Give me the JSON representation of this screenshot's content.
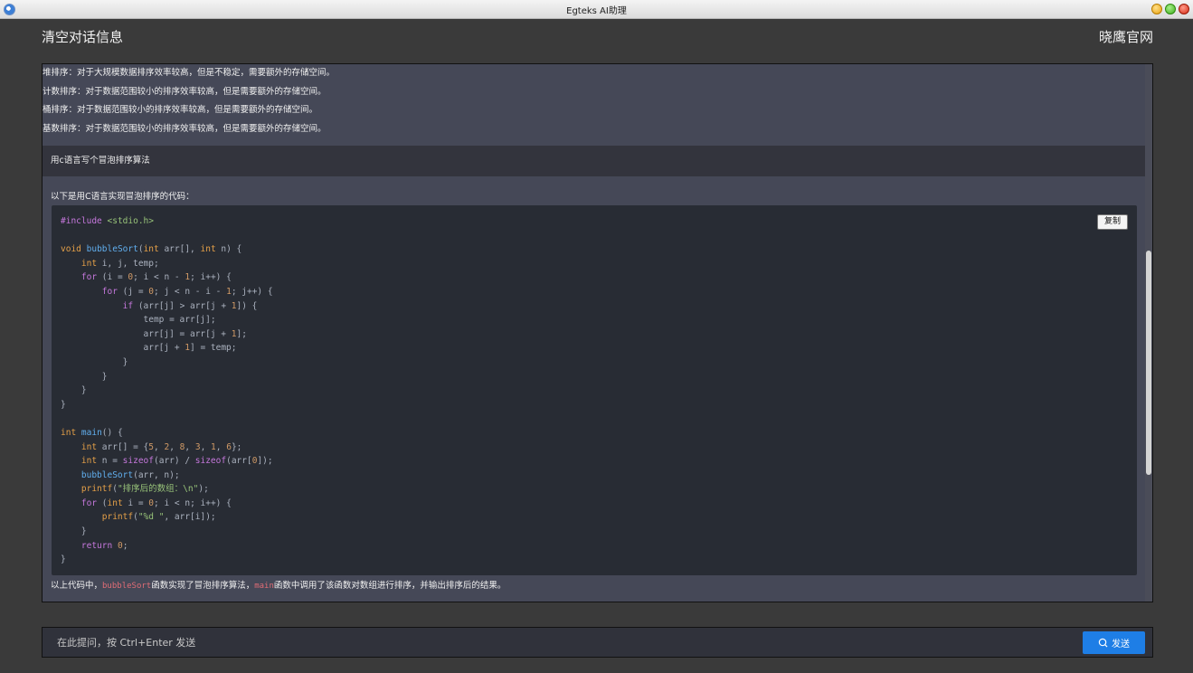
{
  "window": {
    "title": "Egteks AI助理"
  },
  "header": {
    "clear_label": "清空对话信息",
    "site_label": "晓鹰官网"
  },
  "chat": {
    "previous_lines": [
      "堆排序：对于大规模数据排序效率较高，但是不稳定，需要额外的存储空间。",
      "计数排序：对于数据范围较小的排序效率较高，但是需要额外的存储空间。",
      "桶排序：对于数据范围较小的排序效率较高，但是需要额外的存储空间。",
      "基数排序：对于数据范围较小的排序效率较高，但是需要额外的存储空间。"
    ],
    "user_message": "用c语言写个冒泡排序算法",
    "ai_intro": "以下是用C语言实现冒泡排序的代码：",
    "copy_label": "复制",
    "outro": {
      "part1": "以上代码中，",
      "code1": "bubbleSort",
      "part2": "函数实现了冒泡排序算法，",
      "code2": "main",
      "part3": "函数中调用了该函数对数组进行排序，并输出排序后的结果。"
    }
  },
  "code_lines": [
    "#include <stdio.h>",
    "",
    "void bubbleSort(int arr[], int n) {",
    "    int i, j, temp;",
    "    for (i = 0; i < n - 1; i++) {",
    "        for (j = 0; j < n - i - 1; j++) {",
    "            if (arr[j] > arr[j + 1]) {",
    "                temp = arr[j];",
    "                arr[j] = arr[j + 1];",
    "                arr[j + 1] = temp;",
    "            }",
    "        }",
    "    }",
    "}",
    "",
    "int main() {",
    "    int arr[] = {5, 2, 8, 3, 1, 6};",
    "    int n = sizeof(arr) / sizeof(arr[0]);",
    "    bubbleSort(arr, n);",
    "    printf(\"排序后的数组：\\n\");",
    "    for (int i = 0; i < n; i++) {",
    "        printf(\"%d \", arr[i]);",
    "    }",
    "    return 0;",
    "}"
  ],
  "input": {
    "placeholder": "在此提问，按 Ctrl+Enter 发送",
    "value": ""
  },
  "send_label": "发送",
  "colors": {
    "accent": "#1e7ee6",
    "code_bg": "#282c34",
    "panel_bg": "#434551"
  }
}
